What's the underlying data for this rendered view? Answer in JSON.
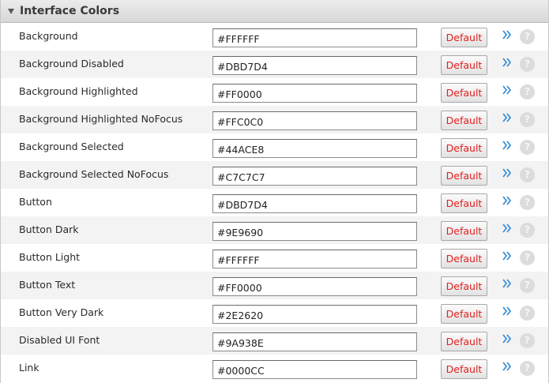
{
  "section": {
    "title": "Interface Colors"
  },
  "rows": [
    {
      "label": "Background",
      "value": "#FFFFFF"
    },
    {
      "label": "Background Disabled",
      "value": "#DBD7D4"
    },
    {
      "label": "Background Highlighted",
      "value": "#FF0000"
    },
    {
      "label": "Background Highlighted NoFocus",
      "value": "#FFC0C0"
    },
    {
      "label": "Background Selected",
      "value": "#44ACE8"
    },
    {
      "label": "Background Selected NoFocus",
      "value": "#C7C7C7"
    },
    {
      "label": "Button",
      "value": "#DBD7D4"
    },
    {
      "label": "Button Dark",
      "value": "#9E9690"
    },
    {
      "label": "Button Light",
      "value": "#FFFFFF"
    },
    {
      "label": "Button Text",
      "value": "#FF0000"
    },
    {
      "label": "Button Very Dark",
      "value": "#2E2620"
    },
    {
      "label": "Disabled UI Font",
      "value": "#9A938E"
    },
    {
      "label": "Link",
      "value": "#0000CC"
    }
  ],
  "default_label": "Default",
  "help_glyph": "?",
  "icons": {
    "collapse": "triangle-down-icon",
    "expand": "double-chevron-right-icon",
    "help": "question-mark-icon"
  },
  "colors": {
    "default_text": "#E02020",
    "expand_icon": "#3A8FD6",
    "help_icon_bg": "#DCDCDC",
    "alt_row_bg": "#F3F3F3"
  }
}
